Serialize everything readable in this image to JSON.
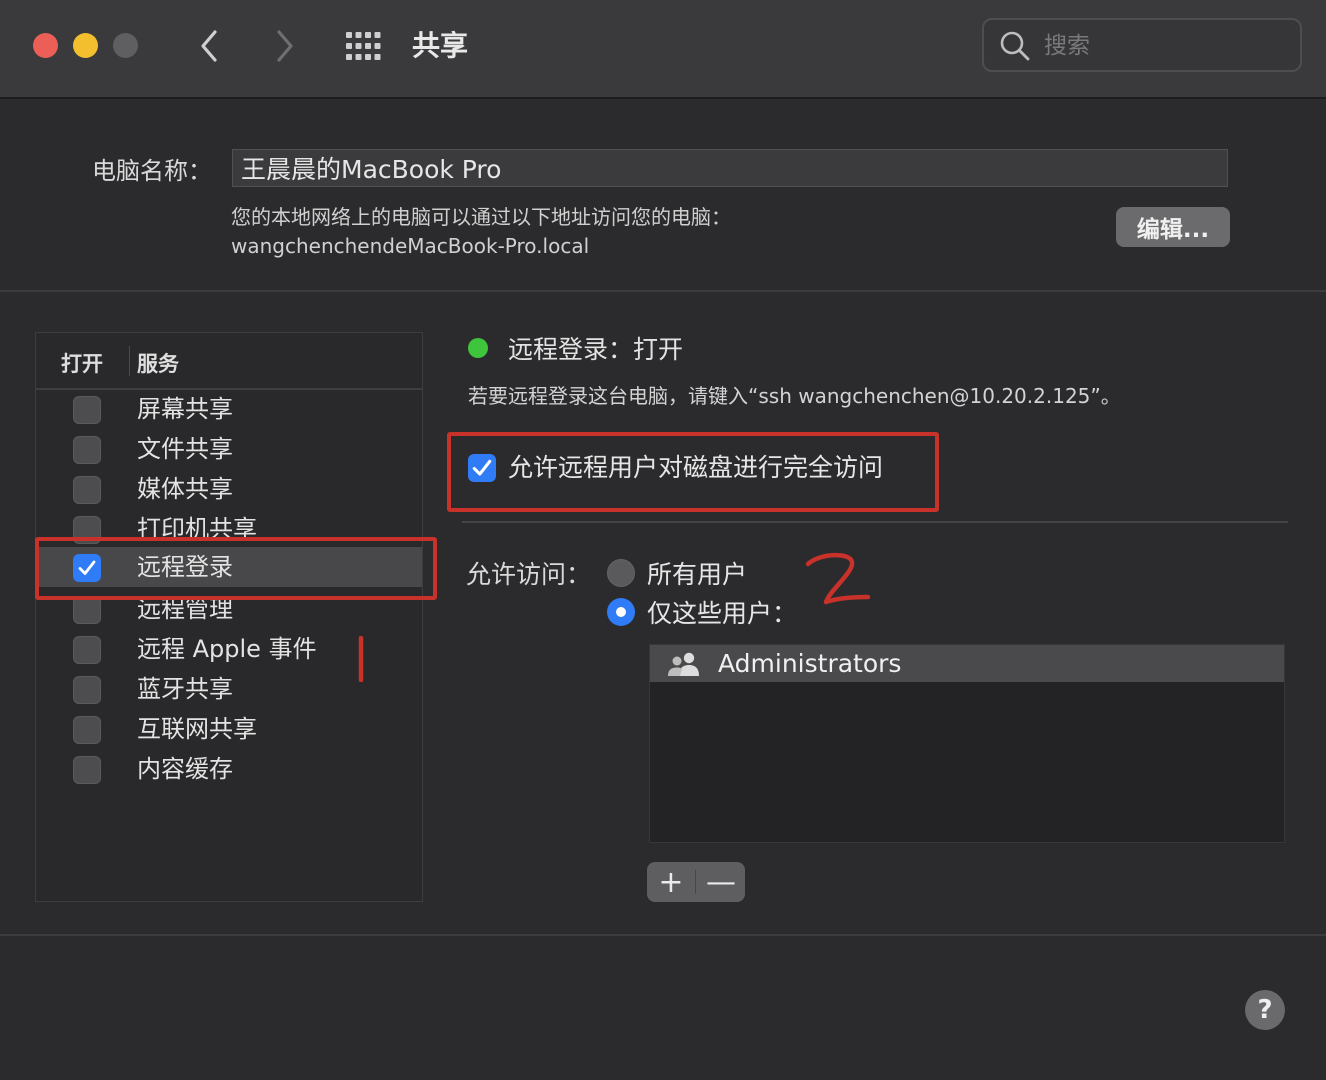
{
  "window": {
    "title": "共享",
    "search_placeholder": "搜索"
  },
  "computer": {
    "name_label": "电脑名称：",
    "name_value": "王晨晨的MacBook Pro",
    "address_info": "您的本地网络上的电脑可以通过以下地址访问您的电脑：",
    "local_address": "wangchenchendeMacBook-Pro.local",
    "edit_button": "编辑..."
  },
  "services": {
    "header_on": "打开",
    "header_service": "服务",
    "items": [
      {
        "label": "屏幕共享",
        "checked": false,
        "selected": false
      },
      {
        "label": "文件共享",
        "checked": false,
        "selected": false
      },
      {
        "label": "媒体共享",
        "checked": false,
        "selected": false
      },
      {
        "label": "打印机共享",
        "checked": false,
        "selected": false
      },
      {
        "label": "远程登录",
        "checked": true,
        "selected": true
      },
      {
        "label": "远程管理",
        "checked": false,
        "selected": false
      },
      {
        "label": "远程 Apple 事件",
        "checked": false,
        "selected": false
      },
      {
        "label": "蓝牙共享",
        "checked": false,
        "selected": false
      },
      {
        "label": "互联网共享",
        "checked": false,
        "selected": false
      },
      {
        "label": "内容缓存",
        "checked": false,
        "selected": false
      }
    ]
  },
  "detail": {
    "status": "远程登录：打开",
    "status_color": "#3ec53c",
    "ssh_hint": "若要远程登录这台电脑，请键入“ssh wangchenchen@10.20.2.125”。",
    "full_disk_access": "允许远程用户对磁盘进行完全访问",
    "full_disk_access_checked": true,
    "allow_access_label": "允许访问：",
    "option_all_users": "所有用户",
    "option_only_these": "仅这些用户：",
    "selected_option": "only_these",
    "users": [
      "Administrators"
    ],
    "add_button": "+",
    "remove_button": "—"
  },
  "help_button": "?",
  "colors": {
    "accent": "#2f7cf6",
    "annotation_red": "#c8322a"
  }
}
